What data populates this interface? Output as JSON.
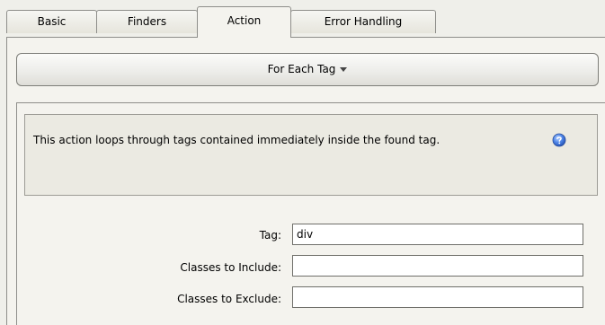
{
  "tabs": [
    {
      "label": "Basic"
    },
    {
      "label": "Finders"
    },
    {
      "label": "Action",
      "active": true
    },
    {
      "label": "Error Handling"
    }
  ],
  "action_selector": {
    "label": "For Each Tag"
  },
  "description": {
    "text": "This action loops through tags contained immediately inside the found tag.",
    "help_icon": "help-icon"
  },
  "form": {
    "tag": {
      "label": "Tag:",
      "value": "div"
    },
    "classes_include": {
      "label": "Classes to Include:",
      "value": ""
    },
    "classes_exclude": {
      "label": "Classes to Exclude:",
      "value": ""
    }
  },
  "colors": {
    "background": "#efefea",
    "panel": "#f4f3ee",
    "info_box": "#ebeae2",
    "border": "#8e8e8a",
    "help_icon_blue": "#3b6fd6"
  }
}
